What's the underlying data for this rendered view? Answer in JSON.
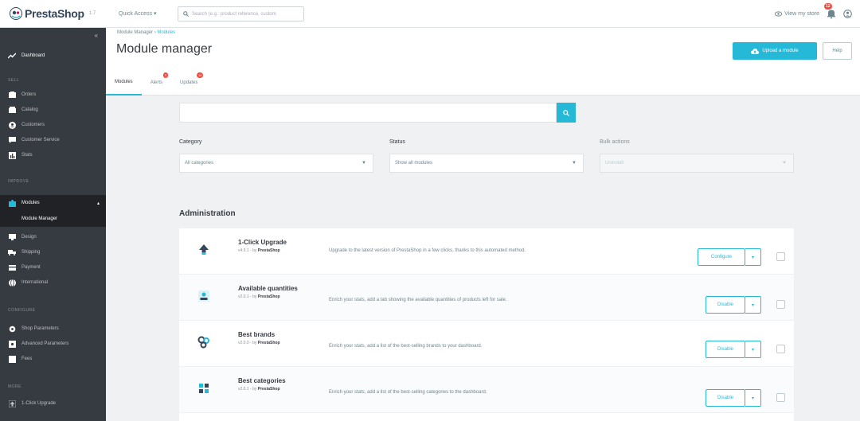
{
  "topbar": {
    "logo": "PrestaShop",
    "version": "1.7",
    "quick_access": "Quick Access ▾",
    "search_placeholder": "Search (e.g.: product reference, custom",
    "view_store": "View my store",
    "notification_count": "12"
  },
  "sidebar": {
    "dashboard": "Dashboard",
    "section_sell": "SELL",
    "sell_items": [
      "Orders",
      "Catalog",
      "Customers",
      "Customer Service",
      "Stats"
    ],
    "section_improve": "IMPROVE",
    "modules": "Modules",
    "module_manager": "Module Manager",
    "improve_items": [
      "Design",
      "Shipping",
      "Payment",
      "International"
    ],
    "section_configure": "CONFIGURE",
    "configure_items": [
      "Shop Parameters",
      "Advanced Parameters",
      "Fees"
    ],
    "section_more": "MORE",
    "more_items": [
      "1-Click Upgrade"
    ]
  },
  "header": {
    "breadcrumb_parent": "Module Manager",
    "breadcrumb_sep": " › ",
    "breadcrumb_current": "Modules",
    "title": "Module manager",
    "upload_button": "Upload a module",
    "help_button": "Help",
    "tabs": [
      {
        "label": "Modules",
        "badge": ""
      },
      {
        "label": "Alerts",
        "badge": "3"
      },
      {
        "label": "Updates",
        "badge": "10"
      }
    ]
  },
  "filters": {
    "category_label": "Category",
    "category_value": "All categories",
    "status_label": "Status",
    "status_value": "Show all modules",
    "bulk_label": "Bulk actions",
    "bulk_value": "Uninstall"
  },
  "section_title": "Administration",
  "modules": [
    {
      "name": "1-Click Upgrade",
      "version": "v4.9.1 - by ",
      "author": "PrestaShop",
      "description": "Upgrade to the latest version of PrestaShop in a few clicks, thanks to this automated method.",
      "action": "Configure"
    },
    {
      "name": "Available quantities",
      "version": "v2.0.1 - by ",
      "author": "PrestaShop",
      "description": "Enrich your stats, add a tab showing the available quantities of products left for sale.",
      "action": "Disable"
    },
    {
      "name": "Best brands",
      "version": "v2.0.0 - by ",
      "author": "PrestaShop",
      "description": "Enrich your stats, add a list of the best-selling brands to your dashboard.",
      "action": "Disable"
    },
    {
      "name": "Best categories",
      "version": "v2.0.1 - by ",
      "author": "PrestaShop",
      "description": "Enrich your stats, add a list of the best-selling categories to the dashboard.",
      "action": "Disable"
    }
  ],
  "colors": {
    "accent": "#25b9d7",
    "sidebar": "#363a41",
    "badge": "#f54c3e"
  }
}
